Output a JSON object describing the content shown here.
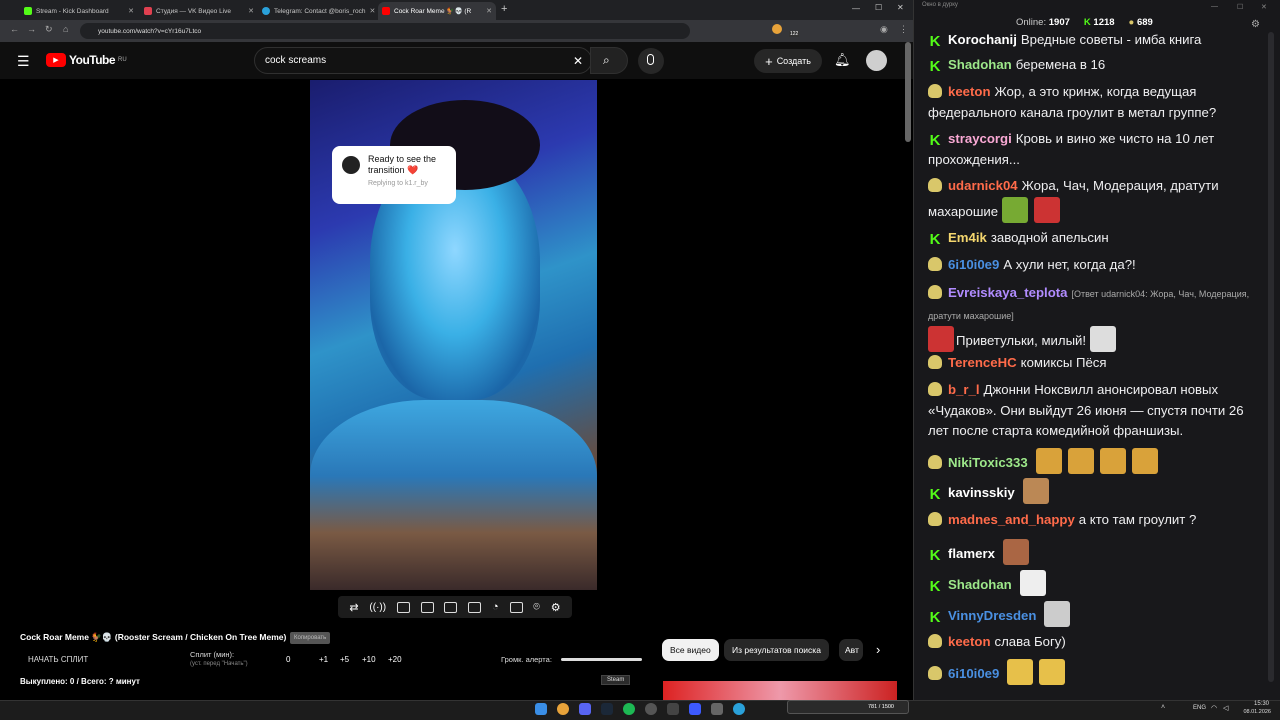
{
  "browser": {
    "tabs": [
      {
        "label": "Stream - Kick Dashboard",
        "color": "#53fc18"
      },
      {
        "label": "Студия — VK Видео Live",
        "color": "#e04050"
      },
      {
        "label": "Telegram: Contact @boris_roch",
        "color": "#2aa1da"
      },
      {
        "label": "Cock Roar Meme 🐓💀 (R",
        "color": "#ff0000"
      }
    ],
    "new_tab": "+",
    "url": "youtube.com/watch?v=cYr16u7Ltco",
    "ext_badge": "122"
  },
  "youtube": {
    "logo": "YouTube",
    "region": "RU",
    "search_value": "cock screams",
    "create_label": "Создать",
    "bubble_text": "Ready to see the transition ❤️",
    "bubble_sub": "Replying to k1.r_by",
    "video_title": "Cock Roar Meme 🐓💀 (Rooster Scream / Chicken On Tree Meme)",
    "copy_label": "Копировать",
    "split_button": "НАЧАТЬ СПЛИТ",
    "split_label": "Сплит (мин):",
    "split_hint": "(уст. перед \"Начать\")",
    "split_values": [
      "0",
      "+1",
      "+5",
      "+10",
      "+20"
    ],
    "alert_volume_label": "Громк. алерта:",
    "bought": "Выкуплено: 0 / Всего: ? минут",
    "chips": [
      "Все видео",
      "Из результатов поиска",
      "Авт"
    ],
    "tooltip": "Steam"
  },
  "chat": {
    "window_title": "Окно в дурку",
    "online_label": "Online:",
    "online": "1907",
    "kick_count": "1218",
    "other_count": "689",
    "messages": [
      {
        "user": "Korochanij",
        "color": "#ffffff",
        "badge": "k",
        "text": "Вредные советы - имба книга"
      },
      {
        "user": "Shadohan",
        "color": "#9de88a",
        "badge": "k",
        "text": "беремена в 16"
      },
      {
        "user": "keeton",
        "color": "#ff6b4a",
        "badge": "y",
        "text": "Жор, а это кринж, когда ведущая федерального канала гроулит в метал группе?"
      },
      {
        "user": "straycorgi",
        "color": "#f9a8d4",
        "badge": "k",
        "text": "Кровь и вино же чисто на 10 лет прохождения..."
      },
      {
        "user": "udarnick04",
        "color": "#ff6b4a",
        "badge": "y",
        "text": "Жора, Чач, Модерация, дратути махарошие"
      },
      {
        "user": "Em4ik",
        "color": "#f5d76e",
        "badge": "k",
        "text": "заводной апельсин"
      },
      {
        "user": "6i10i0e9",
        "color": "#4a90e2",
        "badge": "y",
        "text": "А хули нет, когда да?!"
      },
      {
        "user": "Evreiskaya_teplota",
        "color": "#b18cff",
        "badge": "y",
        "reply": "[Ответ udarnick04: Жора, Чач, Модерация, дратути махарошие]",
        "text": "Приветульки, милый!"
      },
      {
        "user": "TerenceHC",
        "color": "#ff6b4a",
        "badge": "y",
        "text": "комиксы Пёся"
      },
      {
        "user": "b_r_l",
        "color": "#ff6b4a",
        "badge": "y",
        "text": "Джонни Ноксвилл анонсировал новых «Чудаков». Они выйдут 26 июня — спустя почти 26 лет после старта комедийной франшизы."
      },
      {
        "user": "NikiToxic333",
        "color": "#9de88a",
        "badge": "y",
        "text": ""
      },
      {
        "user": "kavinsskiy",
        "color": "#ffffff",
        "badge": "k",
        "text": ""
      },
      {
        "user": "madnes_and_happy",
        "color": "#ff6b4a",
        "badge": "y",
        "text": "а кто там гроулит ?"
      },
      {
        "user": "flamerx",
        "color": "#ffffff",
        "badge": "k",
        "text": ""
      },
      {
        "user": "Shadohan",
        "color": "#9de88a",
        "badge": "k",
        "text": ""
      },
      {
        "user": "VinnyDresden",
        "color": "#4a90e2",
        "badge": "k",
        "text": ""
      },
      {
        "user": "keeton",
        "color": "#ff6b4a",
        "badge": "y",
        "text": "слава Богу)"
      },
      {
        "user": "6i10i0e9",
        "color": "#4a90e2",
        "badge": "y",
        "text": ""
      }
    ]
  },
  "taskbar": {
    "lang": "ENG",
    "time": "15:30",
    "date": "08.01.2026",
    "widget": "781 / 1500"
  }
}
